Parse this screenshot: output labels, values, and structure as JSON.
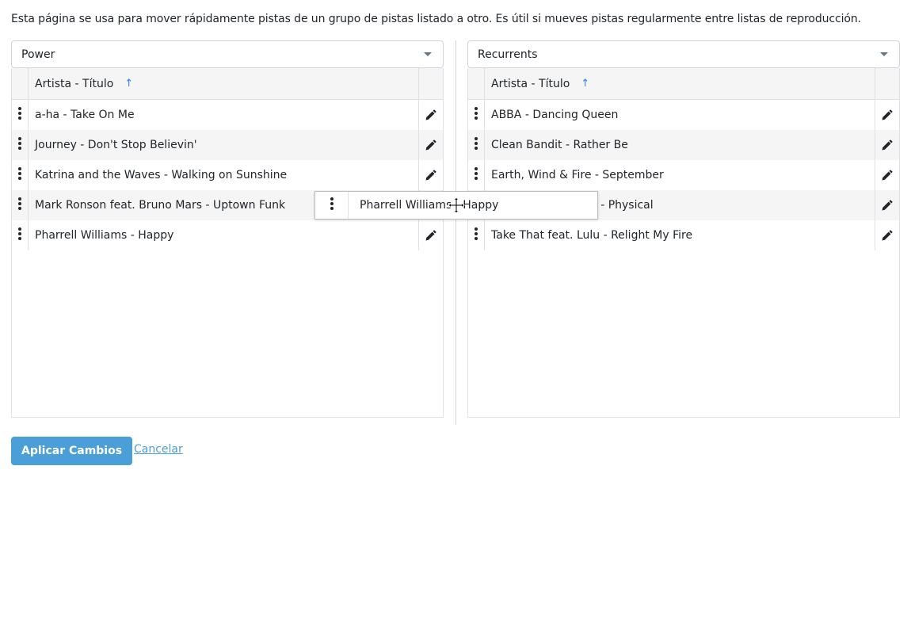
{
  "intro": "Esta página se usa para mover rápidamente pistas de un grupo de pistas listado a otro. Es útil si mueves pistas regularmente entre listas de reproducción.",
  "left": {
    "select_value": "Power",
    "header_title": "Artista - Título",
    "sort_icon": "arrow-up-icon",
    "rows": [
      "a-ha - Take On Me",
      "Journey - Don't Stop Believin'",
      "Katrina and the Waves - Walking on Sunshine",
      "Mark Ronson feat. Bruno Mars - Uptown Funk",
      "Pharrell Williams - Happy"
    ]
  },
  "right": {
    "select_value": "Recurrents",
    "header_title": "Artista - Título",
    "sort_icon": "arrow-up-icon",
    "rows": [
      "ABBA - Dancing Queen",
      "Clean Bandit - Rather Be",
      "Earth, Wind & Fire - September",
      "Olivia Newton-John - Physical",
      "Take That feat. Lulu - Relight My Fire"
    ]
  },
  "drag_ghost": {
    "label": "Pharrell Williams - Happy"
  },
  "actions": {
    "apply": "Aplicar Cambios",
    "cancel": "Cancelar"
  },
  "colors": {
    "accent": "#4a9fd8",
    "sort_arrow": "#2f80ed",
    "stripe": "#f5f5f5"
  },
  "icons": {
    "row_action": "pencil-icon",
    "row_handle": "drag-handle-icon",
    "cursor": "move-cursor-icon"
  }
}
